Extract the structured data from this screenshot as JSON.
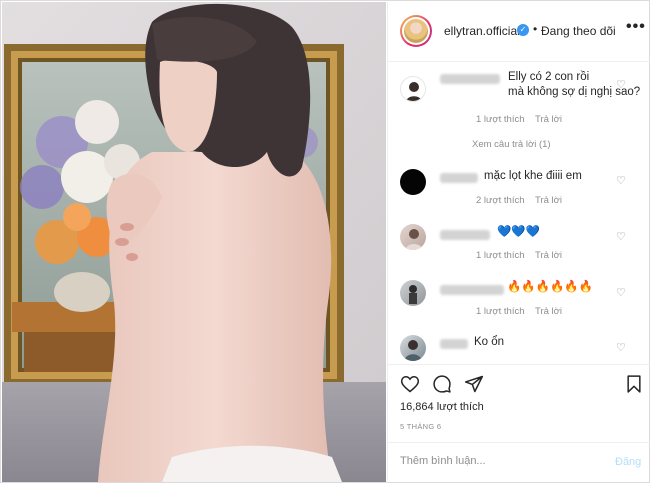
{
  "header": {
    "username": "ellytran.official",
    "verified_icon": "verified-badge-icon",
    "separator": "•",
    "follow_status": "Đang theo dõi",
    "more_label": "•••"
  },
  "comments": [
    {
      "text": "Elly có 2 con rồi\nmà không sợ dị nghị sao?",
      "likes": "1 lượt thích",
      "reply": "Trả lời",
      "view_replies": "Xem câu trả lời (1)"
    },
    {
      "text": "mặc lọt khe điiii em",
      "likes": "2 lượt thích",
      "reply": "Trả lời"
    },
    {
      "text": "💙💙💙",
      "likes": "1 lượt thích",
      "reply": "Trả lời"
    },
    {
      "text": "🔥🔥🔥🔥🔥🔥",
      "likes": "1 lượt thích",
      "reply": "Trả lời"
    },
    {
      "text": "Ko ổn"
    }
  ],
  "actions": {
    "like_icon": "heart-icon",
    "comment_icon": "comment-bubble-icon",
    "share_icon": "share-arrow-icon",
    "save_icon": "bookmark-icon",
    "likes_count": "16,864 lượt thích",
    "date": "5 THÁNG 6"
  },
  "comment_box": {
    "placeholder": "Thêm bình luận...",
    "post_label": "Đăng"
  },
  "colors": {
    "text": "#262626",
    "muted": "#8e8e8e",
    "border": "#efefef",
    "post_disabled": "#b2dffc",
    "verified": "#3897f0"
  }
}
